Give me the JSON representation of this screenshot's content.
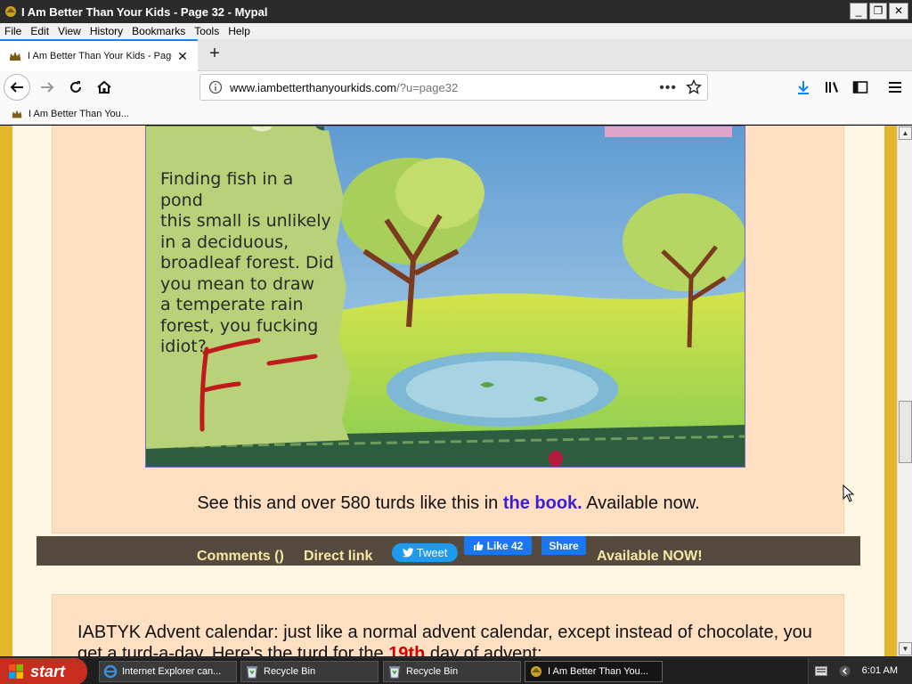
{
  "window": {
    "title": "I Am Better Than Your Kids - Page 32 - Mypal",
    "controls": {
      "minimize": "_",
      "restore": "❐",
      "close": "✕"
    }
  },
  "menu": [
    "File",
    "Edit",
    "View",
    "History",
    "Bookmarks",
    "Tools",
    "Help"
  ],
  "tab": {
    "title": "I Am Better Than Your Kids - Page",
    "close": "✕",
    "new_tab": "+"
  },
  "urlbar": {
    "host": "www.iambetterthanyourkids.com",
    "path": "/?u=page32",
    "more": "•••"
  },
  "bookmarks": [
    {
      "label": "I Am Better Than You..."
    }
  ],
  "comic": {
    "note_lines": [
      "Finding fish in a pond",
      "this small is unlikely",
      "in a deciduous,",
      "broadleaf forest. Did",
      "you mean to draw",
      "a temperate rain",
      "forest, you fucking",
      "idiot?"
    ],
    "grade": "F-"
  },
  "post1": {
    "caption_prefix": "See this and over 580 turds like this in ",
    "caption_link": "the book.",
    "caption_suffix": " Available now."
  },
  "sharebar": {
    "comments": "Comments ()",
    "direct_link": "Direct link",
    "tweet": "Tweet",
    "like": "Like 42",
    "share": "Share",
    "available": "Available NOW!"
  },
  "post2": {
    "text_a": "IABTYK Advent calendar: just like a normal advent calendar, except instead of chocolate, you get a turd-a-day. Here's the turd for the ",
    "day": "19th",
    "text_b": " day of advent:"
  },
  "taskbar": {
    "start": "start",
    "tasks": [
      {
        "label": "Internet Explorer can..."
      },
      {
        "label": "Recycle Bin"
      },
      {
        "label": "Recycle Bin"
      },
      {
        "label": "I Am Better Than You..."
      }
    ],
    "clock": "6:01 AM"
  },
  "colors": {
    "accent": "#0a84ff",
    "page_bg": "#e2b72c",
    "post_bg": "#fedfc1",
    "sharebar": "#554a3d",
    "link": "#3b1fd6"
  }
}
